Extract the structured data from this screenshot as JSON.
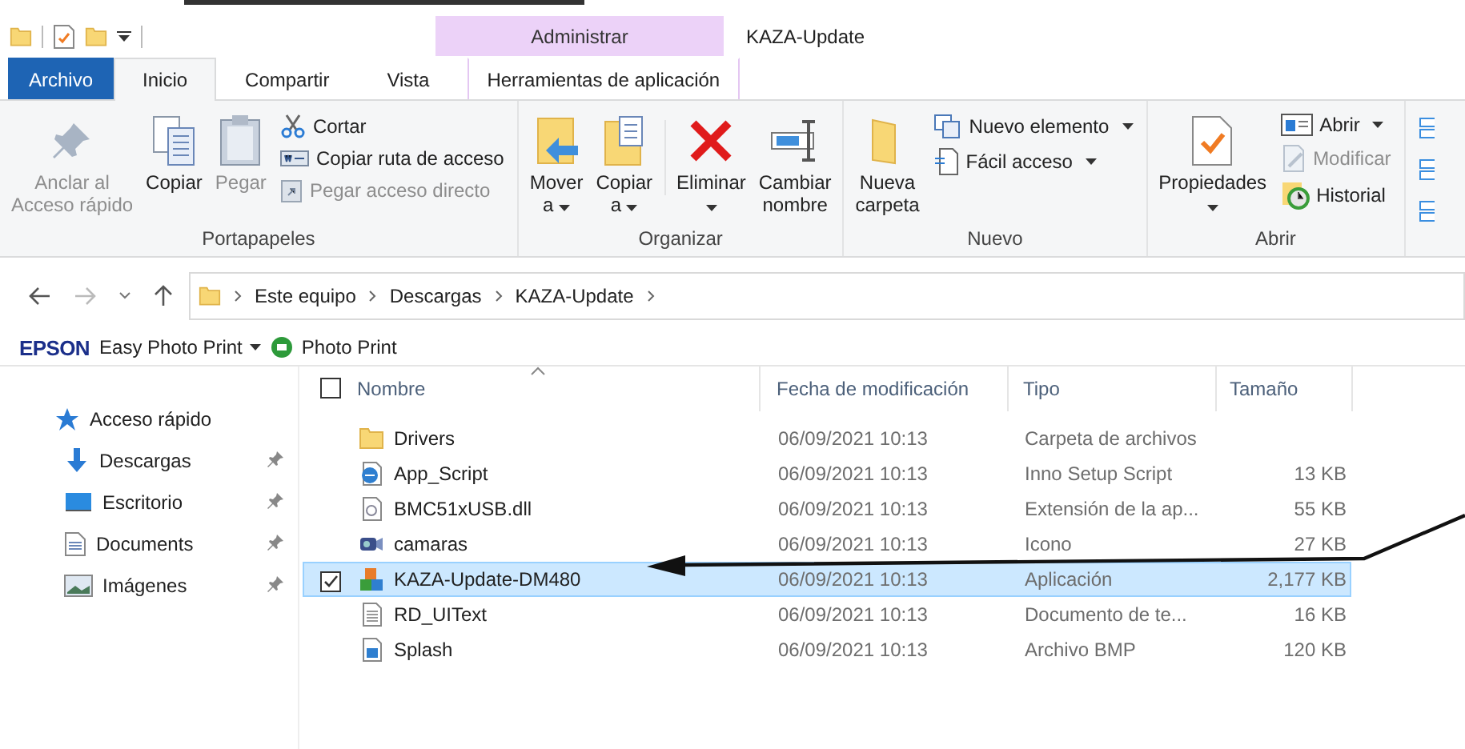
{
  "window": {
    "title": "KAZA-Update",
    "context_header": "Administrar"
  },
  "tabs": [
    {
      "label": "Archivo",
      "kind": "file",
      "selected": false
    },
    {
      "label": "Inicio",
      "kind": "tab",
      "selected": true
    },
    {
      "label": "Compartir",
      "kind": "tab",
      "selected": false
    },
    {
      "label": "Vista",
      "kind": "tab",
      "selected": false
    },
    {
      "label": "Herramientas de aplicación",
      "kind": "context",
      "selected": false
    }
  ],
  "ribbon": [
    {
      "label": "Portapapeles",
      "large": [
        {
          "label": "Anclar al\nAcceso rápido",
          "disabled": true,
          "dropdown": false
        },
        {
          "label": "Copiar",
          "disabled": false,
          "dropdown": false
        },
        {
          "label": "Pegar",
          "disabled": true,
          "dropdown": false
        }
      ],
      "small": [
        {
          "label": "Cortar",
          "disabled": false,
          "dropdown": false
        },
        {
          "label": "Copiar ruta de acceso",
          "disabled": false,
          "dropdown": false
        },
        {
          "label": "Pegar acceso directo",
          "disabled": true,
          "dropdown": false
        }
      ]
    },
    {
      "label": "Organizar",
      "large": [
        {
          "label": "Mover\na",
          "disabled": false,
          "dropdown": true
        },
        {
          "label": "Copiar\na",
          "disabled": false,
          "dropdown": true
        },
        {
          "label": "Eliminar",
          "disabled": false,
          "dropdown": true
        },
        {
          "label": "Cambiar\nnombre",
          "disabled": false,
          "dropdown": false
        }
      ]
    },
    {
      "label": "Nuevo",
      "large": [
        {
          "label": "Nueva\ncarpeta",
          "disabled": false,
          "dropdown": false
        }
      ],
      "small": [
        {
          "label": "Nuevo elemento",
          "disabled": false,
          "dropdown": true
        },
        {
          "label": "Fácil acceso",
          "disabled": false,
          "dropdown": true
        }
      ]
    },
    {
      "label": "Abrir",
      "large": [
        {
          "label": "Propiedades",
          "disabled": false,
          "dropdown": true
        }
      ],
      "small": [
        {
          "label": "Abrir",
          "disabled": false,
          "dropdown": true
        },
        {
          "label": "Modificar",
          "disabled": true,
          "dropdown": false
        },
        {
          "label": "Historial",
          "disabled": false,
          "dropdown": false
        }
      ]
    }
  ],
  "address": {
    "path": [
      "Este equipo",
      "Descargas",
      "KAZA-Update"
    ]
  },
  "epson_bar": {
    "brand": "EPSON",
    "app": "Easy Photo Print",
    "button": "Photo Print"
  },
  "sidebar": {
    "items": [
      {
        "label": "Acceso rápido",
        "kind": "quick",
        "pinned": false
      },
      {
        "label": "Descargas",
        "kind": "downloads",
        "pinned": true
      },
      {
        "label": "Escritorio",
        "kind": "desktop",
        "pinned": true
      },
      {
        "label": "Documents",
        "kind": "documents",
        "pinned": true
      },
      {
        "label": "Imágenes",
        "kind": "pictures",
        "pinned": true
      }
    ]
  },
  "table": {
    "select_all": {
      "checked": false
    },
    "columns": [
      "Nombre",
      "Fecha de modificación",
      "Tipo",
      "Tamaño"
    ],
    "rows": [
      {
        "kind": "folder",
        "name": "Drivers",
        "date": "06/09/2021 10:13",
        "type": "Carpeta de archivos",
        "size": "",
        "selected": false,
        "checked": false
      },
      {
        "kind": "script",
        "name": "App_Script",
        "date": "06/09/2021 10:13",
        "type": "Inno Setup Script",
        "size": "13 KB",
        "selected": false,
        "checked": false
      },
      {
        "kind": "dll",
        "name": "BMC51xUSB.dll",
        "date": "06/09/2021 10:13",
        "type": "Extensión de la ap...",
        "size": "55 KB",
        "selected": false,
        "checked": false
      },
      {
        "kind": "video",
        "name": "camaras",
        "date": "06/09/2021 10:13",
        "type": "Icono",
        "size": "27 KB",
        "selected": false,
        "checked": false
      },
      {
        "kind": "app",
        "name": "KAZA-Update-DM480",
        "date": "06/09/2021 10:13",
        "type": "Aplicación",
        "size": "2,177 KB",
        "selected": true,
        "checked": true
      },
      {
        "kind": "text",
        "name": "RD_UIText",
        "date": "06/09/2021 10:13",
        "type": "Documento de te...",
        "size": "16 KB",
        "selected": false,
        "checked": false
      },
      {
        "kind": "image",
        "name": "Splash",
        "date": "06/09/2021 10:13",
        "type": "Archivo BMP",
        "size": "120 KB",
        "selected": false,
        "checked": false
      }
    ]
  }
}
